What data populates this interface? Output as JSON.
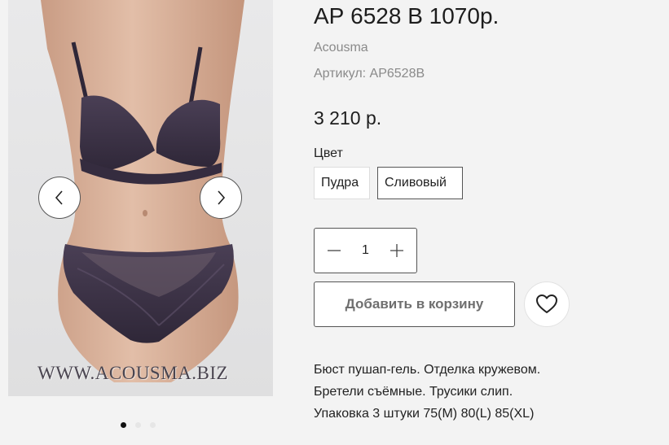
{
  "gallery": {
    "watermark": "WWW.ACOUSMA.BIZ",
    "slides_total": 3,
    "active_slide": 1
  },
  "product": {
    "title": "АР 6528 В 1070р.",
    "brand": "Acousma",
    "sku": "Артикул: АР6528В",
    "price": "3 210 р."
  },
  "color": {
    "label": "Цвет",
    "options": [
      "Пудра",
      "Сливовый"
    ],
    "selected": "Сливовый"
  },
  "quantity": {
    "value": "1"
  },
  "actions": {
    "add_to_cart": "Добавить в корзину"
  },
  "description": {
    "lines": [
      "Бюст пушап-гель. Отделка кружевом.",
      "Бретели съёмные. Трусики слип.",
      "Упаковка 3 штуки 75(M) 80(L) 85(XL)"
    ]
  },
  "icons": {
    "prev": "chevron-left-icon",
    "next": "chevron-right-icon",
    "minus": "minus-icon",
    "plus": "plus-icon",
    "wishlist": "heart-icon"
  },
  "colors": {
    "background": "#f3f3f3",
    "product_fabric": "#3e3447"
  }
}
